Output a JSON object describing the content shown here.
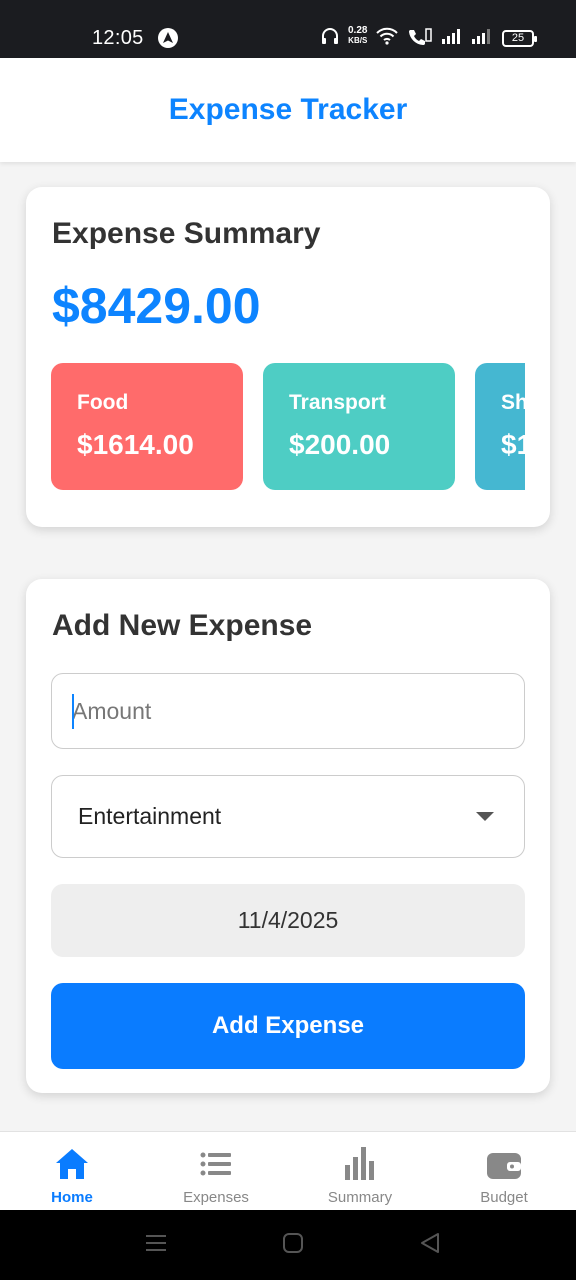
{
  "status_bar": {
    "time": "12:05",
    "network_speed_value": "0.28",
    "network_speed_unit": "KB/S",
    "battery": "25"
  },
  "header": {
    "title": "Expense Tracker"
  },
  "summary": {
    "title": "Expense Summary",
    "total": "$8429.00",
    "categories": [
      {
        "name": "Food",
        "amount": "$1614.00",
        "color": "#ff6b6b"
      },
      {
        "name": "Transport",
        "amount": "$200.00",
        "color": "#4ecdc4"
      },
      {
        "name": "Shopping",
        "amount": "$1",
        "color": "#45b7d1"
      }
    ]
  },
  "form": {
    "title": "Add New Expense",
    "amount_placeholder": "Amount",
    "category_selected": "Entertainment",
    "date": "11/4/2025",
    "submit_label": "Add Expense"
  },
  "tabs": [
    {
      "label": "Home",
      "icon": "home-icon",
      "active": true
    },
    {
      "label": "Expenses",
      "icon": "list-icon",
      "active": false
    },
    {
      "label": "Summary",
      "icon": "bar-chart-icon",
      "active": false
    },
    {
      "label": "Budget",
      "icon": "wallet-icon",
      "active": false
    }
  ],
  "colors": {
    "accent": "#0a7cff",
    "title_blue": "#0d84ff"
  }
}
